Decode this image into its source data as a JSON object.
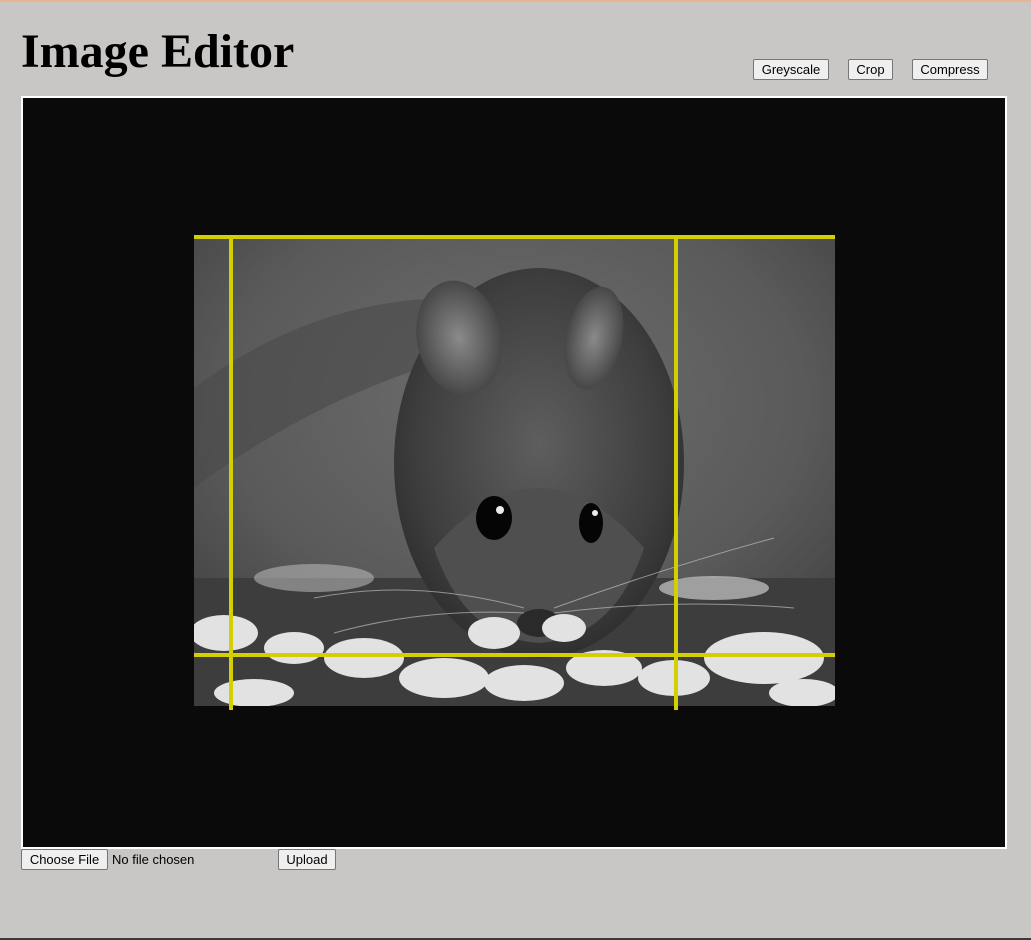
{
  "page": {
    "title": "Image Editor"
  },
  "toolbar": {
    "greyscale_label": "Greyscale",
    "crop_label": "Crop",
    "compress_label": "Compress"
  },
  "canvas": {
    "image_subject": "Greyscale photo of a mouse eating seeds",
    "crop_guide_color": "#d4cf05",
    "background_color": "#0a0a0a"
  },
  "upload": {
    "choose_file_label": "Choose File",
    "file_status": "No file chosen",
    "upload_label": "Upload"
  }
}
